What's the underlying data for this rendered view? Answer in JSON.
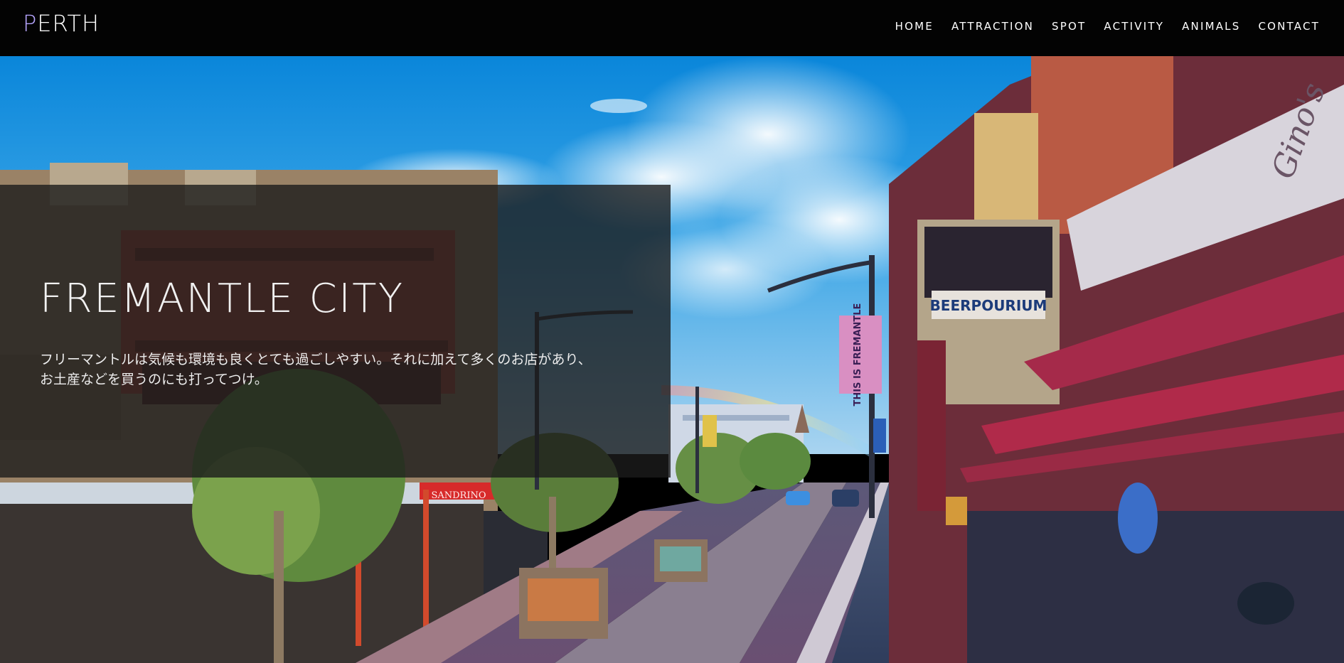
{
  "brand": {
    "first_letter": "P",
    "rest": "ERTH"
  },
  "nav": {
    "items": [
      {
        "label": "HOME"
      },
      {
        "label": "ATTRACTION"
      },
      {
        "label": "SPOT"
      },
      {
        "label": "ACTIVITY"
      },
      {
        "label": "ANIMALS"
      },
      {
        "label": "CONTACT"
      }
    ]
  },
  "hero": {
    "title": "FREMANTLE CITY",
    "description_line1": "フリーマントルは気候も環境も良くとても過ごしやすい。それに加えて多くのお店があり、",
    "description_line2": "お土産などを買うのにも打ってつけ。",
    "photo_signs": {
      "banner": "THIS IS FREMANTLE",
      "pub": "BEERPOURIUM",
      "cafe": "SANDRINO",
      "awning_script": "Gino's"
    }
  },
  "colors": {
    "header_bg": "#030303",
    "logo_accent": "#b7a6ff",
    "overlay": "rgba(28,28,28,0.80)"
  }
}
